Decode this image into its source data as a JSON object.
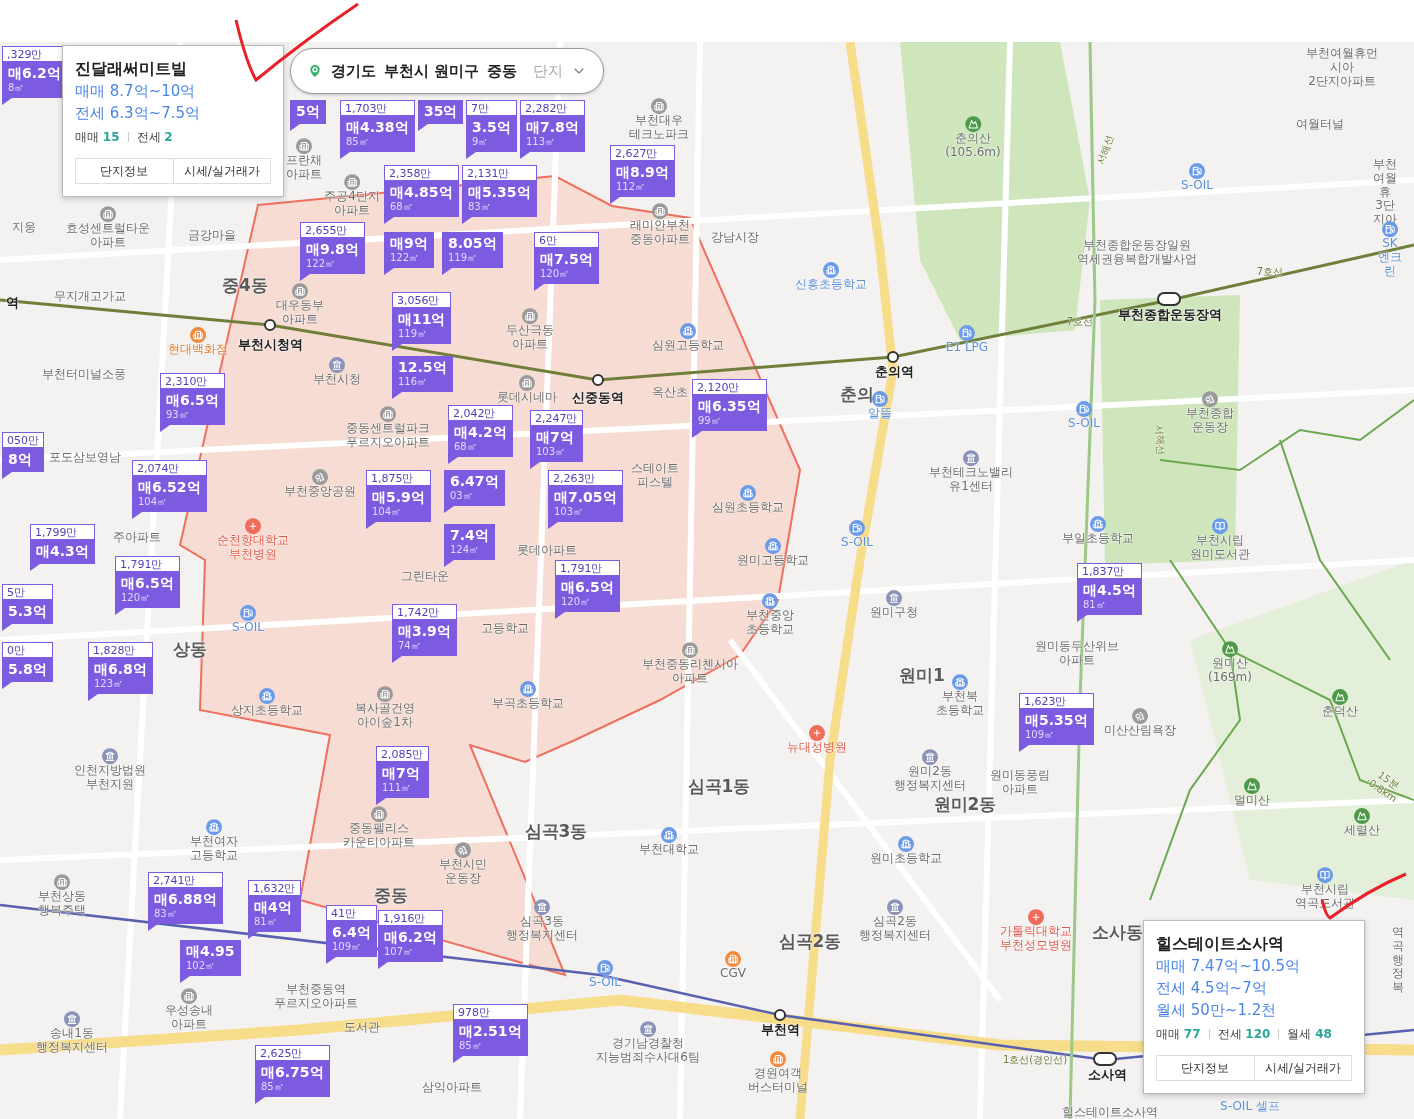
{
  "breadcrumb": {
    "items": [
      "경기도",
      "부천시 원미구",
      "중동"
    ],
    "dropdown": {
      "placeholder": "단지"
    }
  },
  "markers": [
    {
      "unit_price": ",329만",
      "price": "매6.2억",
      "area": "8㎡"
    },
    {
      "price": "5억"
    },
    {
      "unit_price": "1,703만",
      "price": "매4.38억",
      "area": "85㎡"
    },
    {
      "price": "35억"
    },
    {
      "unit_price": "7만",
      "price": "3.5억",
      "area": "9㎡"
    },
    {
      "unit_price": "2,282만",
      "price": "매7.8억",
      "area": "113㎡"
    },
    {
      "unit_price": "2,627만",
      "price": "매8.9억",
      "area": "112㎡"
    },
    {
      "unit_price": "2,358만",
      "price": "매4.85억",
      "area": "68㎡"
    },
    {
      "unit_price": "2,131만",
      "price": "매5.35억",
      "area": "83㎡"
    },
    {
      "unit_price": "2,655만",
      "price": "매9.8억",
      "area": "122㎡"
    },
    {
      "price": "매9억",
      "area": "122㎡"
    },
    {
      "price": "8.05억",
      "area": "119㎡"
    },
    {
      "unit_price": "6만",
      "price": "매7.5억",
      "area": "120㎡"
    },
    {
      "unit_price": "3,056만",
      "price": "매11억",
      "area": "119㎡"
    },
    {
      "price": "12.5억",
      "area": "116㎡"
    },
    {
      "unit_price": "2,310만",
      "price": "매6.5억",
      "area": "93㎡"
    },
    {
      "unit_price": "2,120만",
      "price": "매6.35억",
      "area": "99㎡"
    },
    {
      "unit_price": "2,042만",
      "price": "매4.2억",
      "area": "68㎡"
    },
    {
      "unit_price": "2,247만",
      "price": "매7억",
      "area": "103㎡"
    },
    {
      "unit_price": "050만",
      "price": "8억"
    },
    {
      "unit_price": "2,074만",
      "price": "매6.52억",
      "area": "104㎡"
    },
    {
      "unit_price": "1,875만",
      "price": "매5.9억",
      "area": "104㎡"
    },
    {
      "price": "6.47억",
      "area": "03㎡"
    },
    {
      "unit_price": "2,263만",
      "price": "매7.05억",
      "area": "103㎡"
    },
    {
      "unit_price": "1,799만",
      "price": "매4.3억"
    },
    {
      "price": "7.4억",
      "area": "124㎡"
    },
    {
      "unit_price": "1,791만",
      "price": "매6.5억",
      "area": "120㎡"
    },
    {
      "unit_price": "1,791만",
      "price": "매6.5억",
      "area": "120㎡"
    },
    {
      "unit_price": "1,837만",
      "price": "매4.5억",
      "area": "81㎡"
    },
    {
      "unit_price": "5만",
      "price": "5.3억"
    },
    {
      "unit_price": "1,742만",
      "price": "매3.9억",
      "area": "74㎡"
    },
    {
      "unit_price": "0만",
      "price": "5.8억"
    },
    {
      "unit_price": "1,828만",
      "price": "매6.8억",
      "area": "123㎡"
    },
    {
      "unit_price": "1,623만",
      "price": "매5.35억",
      "area": "109㎡"
    },
    {
      "unit_price": "2,085만",
      "price": "매7억",
      "area": "111㎡"
    },
    {
      "unit_price": "2,741만",
      "price": "매6.88억",
      "area": "83㎡"
    },
    {
      "unit_price": "1,632만",
      "price": "매4억",
      "area": "81㎡"
    },
    {
      "unit_price": "41만",
      "price": "6.4억",
      "area": "109㎡"
    },
    {
      "unit_price": "1,916만",
      "price": "매6.2억",
      "area": "107㎡"
    },
    {
      "price": "매4.95",
      "area": "102㎡"
    },
    {
      "unit_price": "978만",
      "price": "매2.51억",
      "area": "85㎡"
    },
    {
      "unit_price": "2,625만",
      "price": "매6.75억",
      "area": "85㎡"
    }
  ],
  "labels": [
    {
      "text": "지웅",
      "kind": "place"
    },
    {
      "text": "효성센트럴타운\n아파트",
      "kind": "place"
    },
    {
      "text": "금강마을",
      "kind": "place"
    },
    {
      "text": "프란채\n아파트",
      "kind": "place"
    },
    {
      "text": "주공4단지\n아파트",
      "kind": "place"
    },
    {
      "text": "중4동",
      "kind": "district"
    },
    {
      "text": "역",
      "kind": "station"
    },
    {
      "text": "무지개고가교",
      "kind": "place"
    },
    {
      "text": "대우동부\n아파트",
      "kind": "place"
    },
    {
      "text": "현대백화점",
      "kind": "store"
    },
    {
      "text": "부천시청역",
      "kind": "station"
    },
    {
      "text": "부천터미널소풍",
      "kind": "place"
    },
    {
      "text": "부천시청",
      "kind": "place"
    },
    {
      "text": "래미안부천\n중동아파트",
      "kind": "place"
    },
    {
      "text": "두산극동\n아파트",
      "kind": "place"
    },
    {
      "text": "심원고등학교",
      "kind": "place"
    },
    {
      "text": "롯데시네마",
      "kind": "place"
    },
    {
      "text": "신중동역",
      "kind": "station"
    },
    {
      "text": "옥산초",
      "kind": "place"
    },
    {
      "text": "중동센트럴파크\n푸르지오아파트",
      "kind": "place"
    },
    {
      "text": "포도삼보영남",
      "kind": "place"
    },
    {
      "text": "부천중앙공원",
      "kind": "place"
    },
    {
      "text": "주아파트",
      "kind": "place"
    },
    {
      "text": "순천향대학교\n부천병원",
      "kind": "hospital"
    },
    {
      "text": "그린타운",
      "kind": "place"
    },
    {
      "text": "롯데아파트",
      "kind": "place"
    },
    {
      "text": "스테이트\n피스텔",
      "kind": "place"
    },
    {
      "text": "심원초등학교",
      "kind": "place"
    },
    {
      "text": "원미고등학교",
      "kind": "place"
    },
    {
      "text": "부천중앙\n초등학교",
      "kind": "place"
    },
    {
      "text": "부천중동리첸시아\n아파트",
      "kind": "place"
    },
    {
      "text": "S-OIL",
      "kind": "gas"
    },
    {
      "text": "S-OIL",
      "kind": "gas"
    },
    {
      "text": "S-OIL",
      "kind": "gas"
    },
    {
      "text": "S-OIL",
      "kind": "gas"
    },
    {
      "text": "S-OIL",
      "kind": "gas"
    },
    {
      "text": "상동",
      "kind": "district"
    },
    {
      "text": "상지초등학교",
      "kind": "place"
    },
    {
      "text": "고등학교",
      "kind": "place"
    },
    {
      "text": "복사골건영\n아이숲1차",
      "kind": "place"
    },
    {
      "text": "부곡초등학교",
      "kind": "place"
    },
    {
      "text": "인천지방법원\n부천지원",
      "kind": "place"
    },
    {
      "text": "부천여자\n고등학교",
      "kind": "place"
    },
    {
      "text": "중동펠리스\n카운티아파트",
      "kind": "place"
    },
    {
      "text": "부천시민\n운동장",
      "kind": "place"
    },
    {
      "text": "중동",
      "kind": "district"
    },
    {
      "text": "심곡3동",
      "kind": "district"
    },
    {
      "text": "심곡3동\n행정복지센터",
      "kind": "place"
    },
    {
      "text": "부천상동\n행복주택",
      "kind": "place"
    },
    {
      "text": "우성송내\n아파트",
      "kind": "place"
    },
    {
      "text": "부천중동역\n푸르지오아파트",
      "kind": "place"
    },
    {
      "text": "송내1동\n행정복지센터",
      "kind": "place"
    },
    {
      "text": "도서관",
      "kind": "place"
    },
    {
      "text": "삼익아파트",
      "kind": "place"
    },
    {
      "text": "경기남경찰청\n지능범죄수사대6팀",
      "kind": "place"
    },
    {
      "text": "부천역",
      "kind": "station"
    },
    {
      "text": "경원여객\n버스터미널",
      "kind": "place"
    },
    {
      "text": "CGV",
      "kind": "place"
    },
    {
      "text": "심곡2동",
      "kind": "district"
    },
    {
      "text": "심곡2동\n행정복지센터",
      "kind": "place"
    },
    {
      "text": "부천대학교",
      "kind": "place"
    },
    {
      "text": "원미초등학교",
      "kind": "place"
    },
    {
      "text": "심곡1동",
      "kind": "district"
    },
    {
      "text": "뉴대성병원",
      "kind": "hospital"
    },
    {
      "text": "원미2동\n행정복지센터",
      "kind": "place"
    },
    {
      "text": "원미2동",
      "kind": "district"
    },
    {
      "text": "원미동풍림\n아파트",
      "kind": "place"
    },
    {
      "text": "원미구청",
      "kind": "place"
    },
    {
      "text": "원미1",
      "kind": "district"
    },
    {
      "text": "부천북\n초등학교",
      "kind": "place"
    },
    {
      "text": "원미동두산위브\n아파트",
      "kind": "place"
    },
    {
      "text": "부천테크노밸리\n유1센터",
      "kind": "place"
    },
    {
      "text": "부일초등학교",
      "kind": "place"
    },
    {
      "text": "부천시립\n원미도서관",
      "kind": "place"
    },
    {
      "text": "원미산\n(169m)",
      "kind": "place"
    },
    {
      "text": "춘덕산",
      "kind": "place"
    },
    {
      "text": "미산산림욕장",
      "kind": "place"
    },
    {
      "text": "멀미산",
      "kind": "place"
    },
    {
      "text": "세렬산",
      "kind": "place"
    },
    {
      "text": "부천시립\n역곡도서관",
      "kind": "place"
    },
    {
      "text": "가톨릭대학교\n부천성모병원",
      "kind": "hospital"
    },
    {
      "text": "소사동",
      "kind": "district"
    },
    {
      "text": "소사역",
      "kind": "station"
    },
    {
      "text": "1호선(경인선)",
      "kind": "rail"
    },
    {
      "text": "S-OIL 셀프",
      "kind": "gas"
    },
    {
      "text": "힐스테이트소사역",
      "kind": "place"
    },
    {
      "text": "역곡\n행정복",
      "kind": "place"
    },
    {
      "text": "강남시장",
      "kind": "place"
    },
    {
      "text": "신흥초등학교",
      "kind": "gas"
    },
    {
      "text": "E1 LPG",
      "kind": "gas"
    },
    {
      "text": "춘의역",
      "kind": "station"
    },
    {
      "text": "춘의",
      "kind": "district"
    },
    {
      "text": "알뜰",
      "kind": "gas"
    },
    {
      "text": "춘의산\n(105.6m)",
      "kind": "place"
    },
    {
      "text": "부천종합운동장일원\n역세권융복합개발사업",
      "kind": "place"
    },
    {
      "text": "7호선",
      "kind": "rail"
    },
    {
      "text": "7호선",
      "kind": "rail"
    },
    {
      "text": "부천종합운동장역",
      "kind": "station"
    },
    {
      "text": "부천종합\n운동장",
      "kind": "place"
    },
    {
      "text": "부천여월휴먼시아\n2단지아파트",
      "kind": "place"
    },
    {
      "text": "여월터널",
      "kind": "place"
    },
    {
      "text": "부천여월휴\n3단지아",
      "kind": "place"
    },
    {
      "text": "SK엔크린",
      "kind": "gas"
    },
    {
      "text": "부천대우\n테크노파크",
      "kind": "place"
    },
    {
      "text": "서해선",
      "kind": "rail"
    },
    {
      "text": "서해선",
      "kind": "rail"
    },
    {
      "text": "15분·0.8km",
      "kind": "rail"
    }
  ],
  "popups": [
    {
      "title": "진달래써미트빌",
      "prices": [
        "매매 8.7억~10억",
        "전세 6.3억~7.5억"
      ],
      "counts": [
        {
          "label": "매매",
          "value": "15"
        },
        {
          "label": "전세",
          "value": "2"
        }
      ],
      "buttons": [
        "단지정보",
        "시세/실거래가"
      ]
    },
    {
      "title": "힐스테이트소사역",
      "prices": [
        "매매 7.47억~10.5억",
        "전세 4.5억~7억",
        "월세 50만~1.2천"
      ],
      "counts": [
        {
          "label": "매매",
          "value": "77"
        },
        {
          "label": "전세",
          "value": "120"
        },
        {
          "label": "월세",
          "value": "48"
        }
      ],
      "buttons": [
        "단지정보",
        "시세/실거래가"
      ]
    }
  ]
}
